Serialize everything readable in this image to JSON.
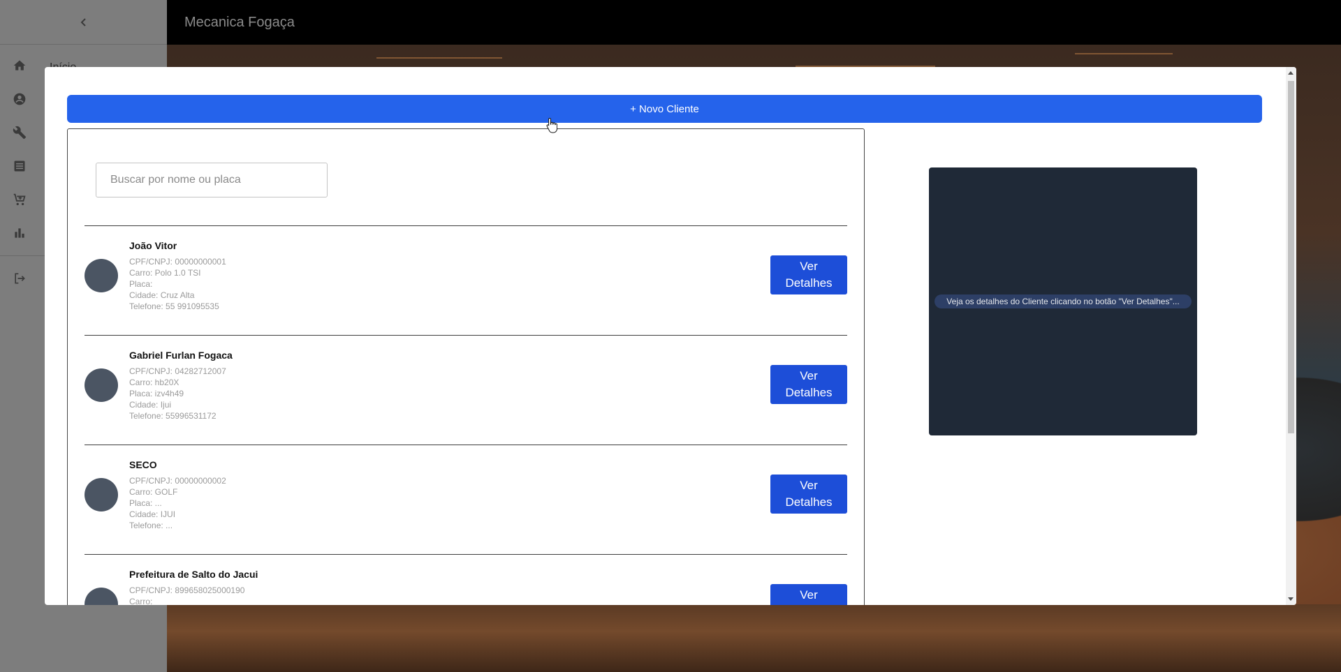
{
  "app": {
    "title": "Mecanica Fogaça"
  },
  "sidebar": {
    "collapse_icon": "chevron-left-icon",
    "items": [
      {
        "icon": "home-icon",
        "label": "Início"
      },
      {
        "icon": "account-circle-icon",
        "label": ""
      },
      {
        "icon": "wrench-icon",
        "label": ""
      },
      {
        "icon": "list-icon",
        "label": ""
      },
      {
        "icon": "cart-icon",
        "label": ""
      },
      {
        "icon": "bar-chart-icon",
        "label": ""
      }
    ],
    "logout_icon": "logout-icon"
  },
  "modal": {
    "new_client_label": "+ Novo Cliente",
    "search": {
      "placeholder": "Buscar por nome ou placa",
      "value": ""
    },
    "clients": [
      {
        "name": "João Vitor",
        "cpf": "CPF/CNPJ: 00000000001",
        "carro": "Carro: Polo 1.0 TSI",
        "placa": "Placa:",
        "cidade": "Cidade: Cruz Alta",
        "telefone": "Telefone: 55 991095535",
        "button": "Ver Detalhes"
      },
      {
        "name": "Gabriel Furlan Fogaca",
        "cpf": "CPF/CNPJ: 04282712007",
        "carro": "Carro: hb20X",
        "placa": "Placa: izv4h49",
        "cidade": "Cidade: Ijui",
        "telefone": "Telefone: 55996531172",
        "button": "Ver Detalhes"
      },
      {
        "name": "SECO",
        "cpf": "CPF/CNPJ: 00000000002",
        "carro": "Carro: GOLF",
        "placa": "Placa: ...",
        "cidade": "Cidade: IJUI",
        "telefone": "Telefone: ...",
        "button": "Ver Detalhes"
      },
      {
        "name": "Prefeitura de Salto do Jacui",
        "cpf": "CPF/CNPJ: 899658025000190",
        "carro": "Carro:",
        "placa": "",
        "cidade": "",
        "telefone": "",
        "button": "Ver Detalhes"
      }
    ],
    "details_hint": "Veja os detalhes do Cliente clicando no botão \"Ver Detalhes\"..."
  },
  "colors": {
    "primary": "#2563eb",
    "details_button": "#1d4ed8",
    "details_panel": "#1f2937",
    "appbar": "#000000"
  }
}
